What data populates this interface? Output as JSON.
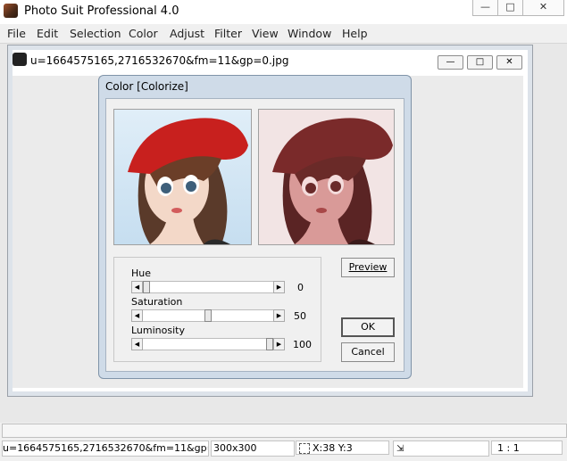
{
  "app": {
    "title": "Photo Suit Professional 4.0",
    "min": "—",
    "max": "□",
    "close": "✕"
  },
  "menu": [
    "File",
    "Edit",
    "Selection",
    "Color",
    "Adjust",
    "Filter",
    "View",
    "Window",
    "Help"
  ],
  "child": {
    "title": "u=1664575165,2716532670&fm=11&gp=0.jpg",
    "min": "—",
    "max": "□",
    "close": "✕"
  },
  "dialog": {
    "title": "Color [Colorize]",
    "hue": {
      "label": "Hue",
      "value": "0",
      "level": 0.0
    },
    "saturation": {
      "label": "Saturation",
      "value": "50",
      "level": 0.5
    },
    "luminosity": {
      "label": "Luminosity",
      "value": "100",
      "level": 1.0
    },
    "preview_label": "Preview",
    "ok_label": "OK",
    "cancel_label": "Cancel"
  },
  "status": {
    "filename": "u=1664575165,2716532670&fm=11&gp=0",
    "size": "300x300",
    "coords": "X:38 Y:3",
    "zoom": "1 : 1"
  },
  "colors": {
    "dialog_frame": "#cfdbe8",
    "hat": "#c8201e",
    "preview_tint": "#c46a68"
  }
}
